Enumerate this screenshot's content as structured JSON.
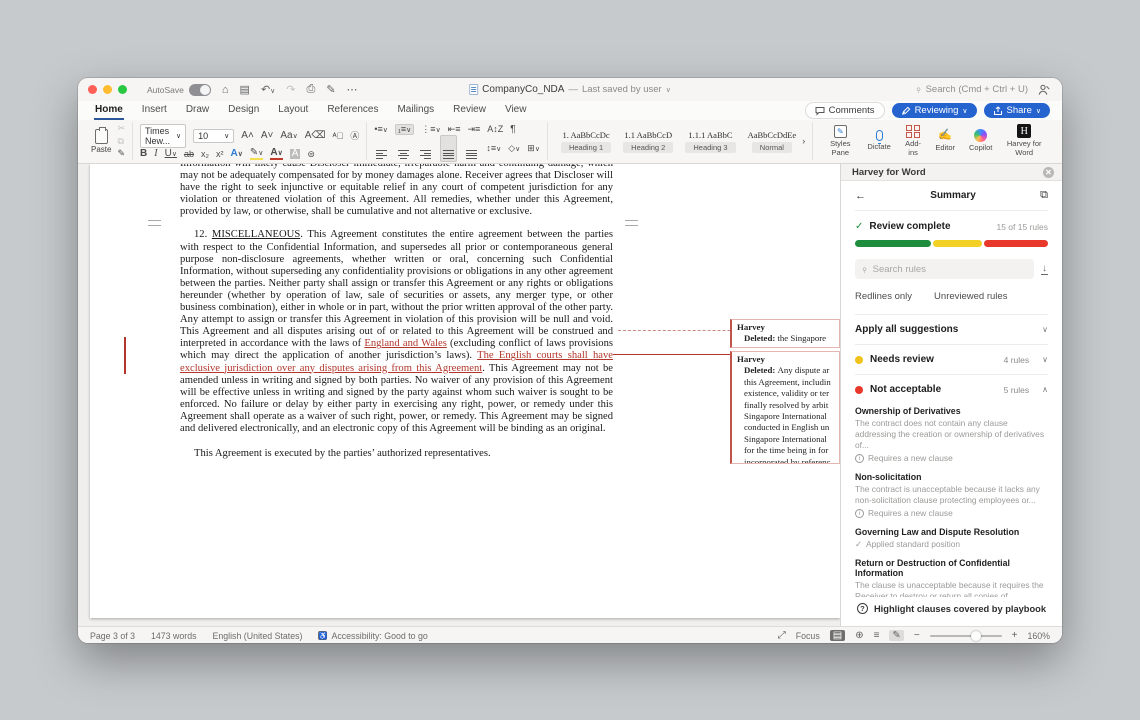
{
  "chrome": {
    "autosave": "AutoSave",
    "doc_title": "CompanyCo_NDA",
    "saved_status": "Last saved by user",
    "search_placeholder": "Search (Cmd + Ctrl + U)",
    "tabs": [
      "Home",
      "Insert",
      "Draw",
      "Design",
      "Layout",
      "References",
      "Mailings",
      "Review",
      "View"
    ],
    "comments_label": "Comments",
    "reviewing_label": "Reviewing",
    "share_label": "Share",
    "accent_blue": "#2563cf"
  },
  "ribbon": {
    "paste_label": "Paste",
    "font_name": "Times New...",
    "font_size": "10",
    "styles": [
      {
        "preview": "1.  AaBbCcDc",
        "name": "Heading 1"
      },
      {
        "preview": "1.1  AaBbCcD",
        "name": "Heading 2"
      },
      {
        "preview": "1.1.1  AaBbC",
        "name": "Heading 3"
      },
      {
        "preview": "AaBbCcDdEe",
        "name": "Normal"
      }
    ],
    "tools": [
      "Styles Pane",
      "Dictate",
      "Add-ins",
      "Editor",
      "Copilot",
      "Harvey for Word"
    ]
  },
  "document": {
    "insert_color": "#b3362c",
    "para_remedies": "Information will likely cause Discloser immediate, irreparable harm and continuing damage, which may not be adequately compensated for by money damages alone. Receiver agrees that Discloser will have the right to seek injunctive or equitable relief in any court of competent jurisdiction for any violation or threatened violation of this Agreement.  All remedies, whether under this Agreement, provided by law, or otherwise, shall be cumulative and not alternative or exclusive.",
    "para12_num": "12. ",
    "para12_heading": "MISCELLANEOUS",
    "para12_body1": ". This Agreement constitutes the entire agreement between the parties with respect to the Confidential Information, and supersedes all prior or contemporaneous general purpose non-disclosure agreements, whether written or oral, concerning such Confidential Information, without superseding any confidentiality provisions or obligations in any other agreement between the parties. Neither party shall assign or transfer this Agreement or any rights or obligations hereunder (whether by operation of law, sale of securities or assets, any merger type, or other business combination), either in whole or in part, without the prior written approval of the other party. Any attempt to assign or transfer this Agreement in violation of this provision will be null and void. This Agreement and all disputes arising out of or related to this Agreement will be construed and interpreted in accordance with the laws of ",
    "insertion1": "England and Wales",
    "para12_body2": " (excluding conflict of laws provisions which may direct the application of another jurisdiction’s laws). ",
    "insertion2": "The English courts shall have exclusive jurisdiction over any disputes arising from this Agreement",
    "para12_body3": ". This Agreement may not be amended unless in writing and signed by both parties. No waiver of any provision of this Agreement will be effective unless in writing and signed by the party against whom such waiver is sought to be enforced. No failure or delay by either party in exercising any right, power, or remedy under this Agreement shall operate as a waiver of such right, power, or remedy. This Agreement may be signed and delivered electronically, and an electronic copy of this Agreement will be binding as an original.",
    "execution_line": "This Agreement is executed by the parties’ authorized representatives."
  },
  "callouts": [
    {
      "author": "Harvey",
      "action": "Deleted: ",
      "text": "the Singapore"
    },
    {
      "author": "Harvey",
      "action": "Deleted: ",
      "text": "Any dispute ar\nthis Agreement, includin\nexistence, validity or ter\nfinally resolved by arbit\nSingapore International\nconducted in English un\nSingapore International\nfor the time being in for\nincorporated by referenc"
    }
  ],
  "harvey": {
    "title": "Harvey for Word",
    "view_title": "Summary",
    "status_label": "Review complete",
    "rules_total": "15 of 15 rules",
    "progress": {
      "green_pct": 40,
      "yellow_pct": 26,
      "red_pct": 34,
      "green": "#1e8e3e",
      "yellow": "#f2d024",
      "red": "#e8382c"
    },
    "search_placeholder": "Search rules",
    "filter1": "Redlines only",
    "filter2": "Unreviewed rules",
    "apply_all": "Apply all suggestions",
    "needs_review_label": "Needs review",
    "needs_review_count": "4 rules",
    "not_acceptable_label": "Not acceptable",
    "not_acceptable_count": "5 rules",
    "cards": [
      {
        "title": "Ownership of Derivatives",
        "desc": "The contract does not contain any clause addressing the creation or ownership of derivatives of...",
        "note": "Requires a new clause"
      },
      {
        "title": "Non-solicitation",
        "desc": "The contract is unacceptable because it lacks any non-solicitation clause protecting employees or...",
        "note": "Requires a new clause"
      },
      {
        "title": "Governing Law and Dispute Resolution",
        "desc": "",
        "note": "Applied standard position"
      },
      {
        "title": "Return or Destruction of Confidential Information",
        "desc": "The clause is unacceptable because it requires the Receiver to destroy or return all copies of Confidenti...",
        "note": ""
      }
    ],
    "footer_action": "Highlight clauses covered by playbook"
  },
  "statusbar": {
    "page": "Page 3 of 3",
    "words": "1473 words",
    "language": "English (United States)",
    "accessibility": "Accessibility: Good to go",
    "focus": "Focus",
    "zoom": "160%"
  }
}
